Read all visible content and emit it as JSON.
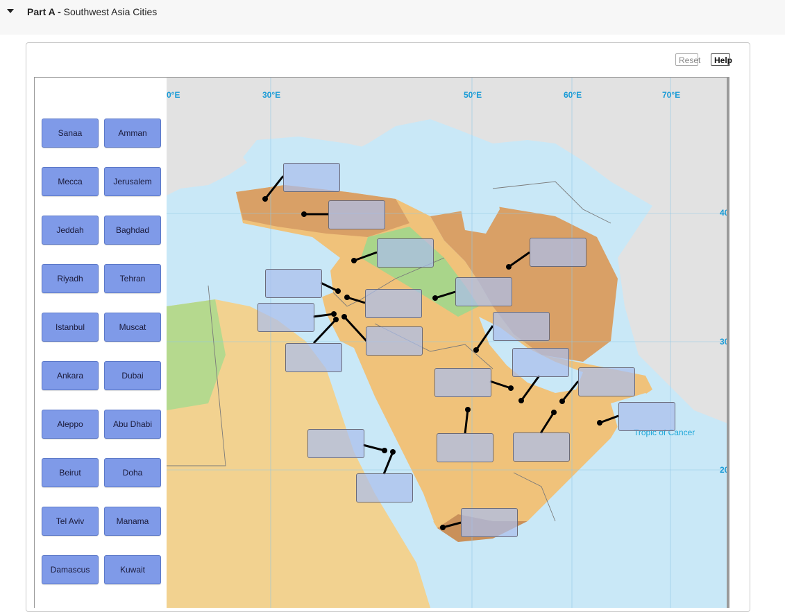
{
  "part": {
    "prefix": "Part A -",
    "title": "Southwest Asia Cities"
  },
  "controls": {
    "reset": "Reset",
    "help": "Help"
  },
  "labels": [
    "Sanaa",
    "Amman",
    "Mecca",
    "Jerusalem",
    "Jeddah",
    "Baghdad",
    "Riyadh",
    "Tehran",
    "Istanbul",
    "Muscat",
    "Ankara",
    "Dubai",
    "Aleppo",
    "Abu Dhabi",
    "Beirut",
    "Doha",
    "Tel Aviv",
    "Manama",
    "Damascus",
    "Kuwait"
  ],
  "map": {
    "longitudes": [
      "0°E",
      "30°E",
      "50°E",
      "60°E",
      "70°E"
    ],
    "latitudes": [
      "40",
      "30",
      "20"
    ],
    "tropic": "Tropic of Cancer",
    "drop_target_count": 20,
    "colors": {
      "water": "#c9e8f7",
      "land_other": "#e4e4e4",
      "lowland": "#a9d58a",
      "upland": "#f0c27a",
      "highland": "#d9a066",
      "label_fill": "#7f9ae8",
      "target_fill": "#aabeeb"
    }
  }
}
